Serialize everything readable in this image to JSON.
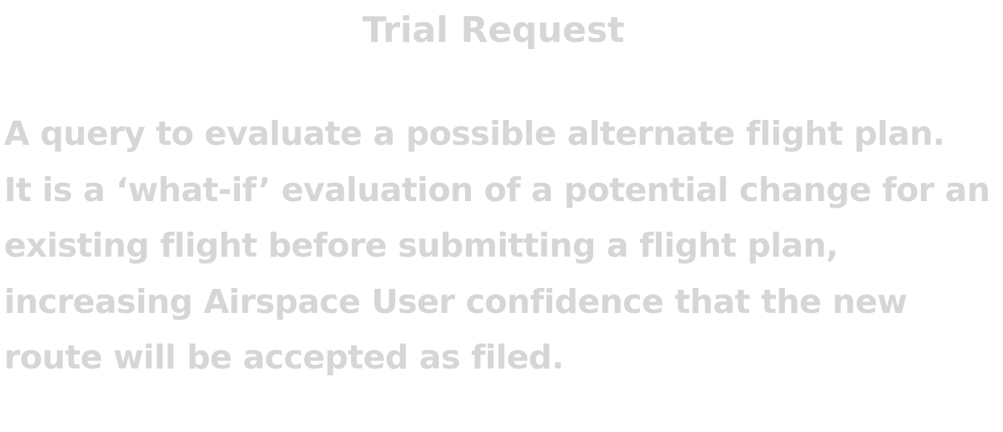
{
  "card": {
    "title": "Trial Request",
    "description_lines": [
      "A query to evaluate a possible alternate flight plan.",
      "It is a ‘what-if’ evaluation of a potential change for an",
      "existing flight before submitting a flight plan,",
      "increasing Airspace User confidence that the new",
      "route will be accepted as filed."
    ]
  }
}
